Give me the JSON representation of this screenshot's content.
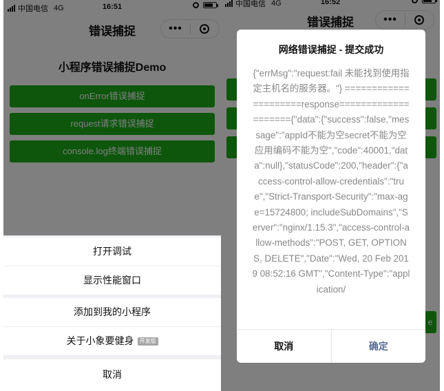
{
  "left": {
    "status": {
      "carrier": "中国电信",
      "network": "4G",
      "time": "16:51"
    },
    "nav": {
      "title": "错误捕捉",
      "more": "•••"
    },
    "page": {
      "heading": "小程序错误捕捉Demo",
      "buttons": [
        "onError错误捕捉",
        "request请求错误捕捉",
        "console.log终端错误捕捉"
      ]
    },
    "action_sheet": {
      "items": [
        "打开调试",
        "显示性能窗口",
        "添加到我的小程序",
        "关于小象要健身"
      ],
      "dev_badge": "开发版",
      "cancel": "取消"
    }
  },
  "right": {
    "status": {
      "carrier": "中国电信",
      "network": "4G",
      "time": "16:52"
    },
    "nav": {
      "title": "错误捕捉",
      "more": "•••"
    },
    "partial_button_text": "e",
    "modal": {
      "title": "网络错误捕捉 - 提交成功",
      "content": "{\"errMsg\":\"request:fail 未能找到使用指定主机名的服务器。\"} =====================response===================={\"data\":{\"success\":false,\"message\":\"appId不能为空secret不能为空应用编码不能为空\",\"code\":40001,\"data\":null},\"statusCode\":200,\"header\":{\"access-control-allow-credentials\":\"true\",\"Strict-Transport-Security\":\"max-age=15724800; includeSubDomains\",\"Server\":\"nginx/1.15.3\",\"access-control-allow-methods\":\"POST, GET, OPTIONS, DELETE\",\"Date\":\"Wed, 20 Feb 2019 08:52:16 GMT\",\"Content-Type\":\"application/",
      "cancel": "取消",
      "confirm": "确定"
    }
  },
  "colors": {
    "wechat_green": "#1aad19",
    "modal_link": "#576b95",
    "overlay": "rgba(0,0,0,0.5)"
  }
}
